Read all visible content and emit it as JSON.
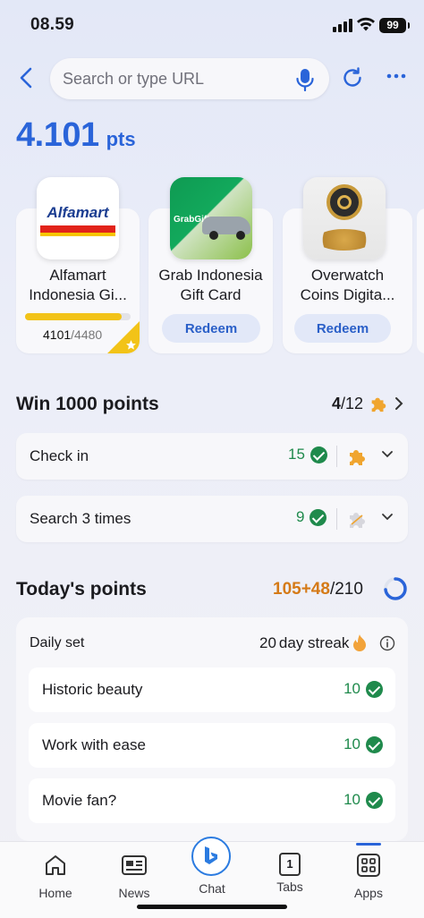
{
  "status": {
    "time": "08.59",
    "battery": "99"
  },
  "browser": {
    "search_placeholder": "Search or type URL"
  },
  "points": {
    "value": "4.101",
    "unit": "pts"
  },
  "rewards": [
    {
      "title_line1": "Alfamart",
      "title_line2": "Indonesia Gi...",
      "progress_current": "4101",
      "progress_total": "/4480",
      "progress_fraction": 0.915,
      "logo_text": "Alfamart"
    },
    {
      "title_line1": "Grab Indonesia",
      "title_line2": "Gift Card",
      "button": "Redeem",
      "logo_text": "GrabGifts"
    },
    {
      "title_line1": "Overwatch",
      "title_line2": "Coins Digita...",
      "button": "Redeem"
    }
  ],
  "win": {
    "title": "Win 1000 points",
    "progress_current": "4",
    "progress_total": "/12"
  },
  "tasks": [
    {
      "label": "Check in",
      "value": "15"
    },
    {
      "label": "Search 3 times",
      "value": "9"
    }
  ],
  "today": {
    "title": "Today's points",
    "earned": "105",
    "bonus": "+48",
    "total": "/210",
    "ring_fraction": 0.73
  },
  "daily_set": {
    "label": "Daily set",
    "streak_count": "20",
    "streak_text": "day streak",
    "items": [
      {
        "label": "Historic beauty",
        "value": "10"
      },
      {
        "label": "Work with ease",
        "value": "10"
      },
      {
        "label": "Movie fan?",
        "value": "10"
      }
    ]
  },
  "nav": [
    {
      "label": "Home",
      "icon": "home-icon"
    },
    {
      "label": "News",
      "icon": "news-icon"
    },
    {
      "label": "Chat",
      "icon": "bing-chat-icon"
    },
    {
      "label": "Tabs",
      "icon": "tabs-icon",
      "count": "1"
    },
    {
      "label": "Apps",
      "icon": "apps-grid-icon"
    }
  ],
  "colors": {
    "accent": "#2a64d9",
    "success": "#1f8a4c",
    "gold": "#f2c318",
    "orange": "#d57a17"
  }
}
